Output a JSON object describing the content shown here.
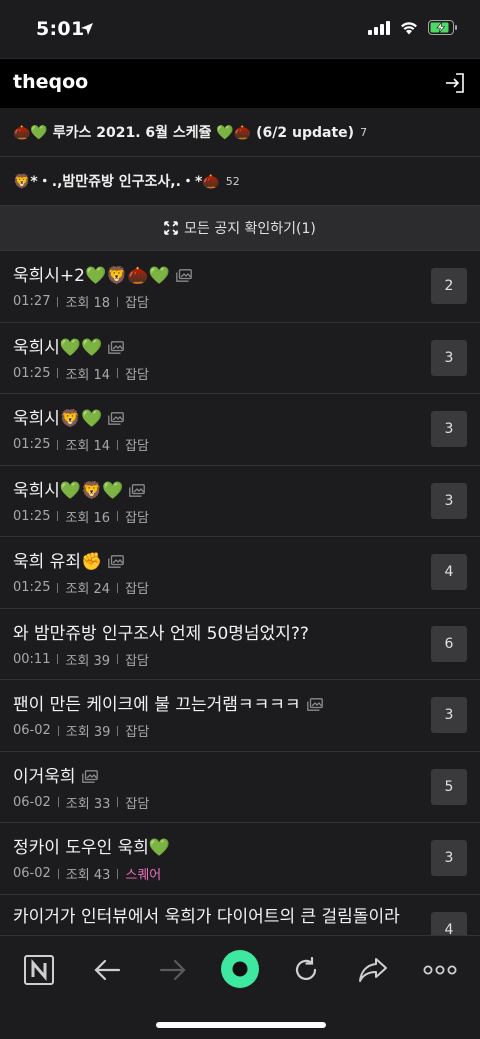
{
  "status": {
    "time": "5:01"
  },
  "nav": {
    "title": "theqoo"
  },
  "notices": [
    {
      "text": "🌰💚 루카스 2021. 6월 스케쥴 💚🌰 (6/2 update)",
      "count": "7"
    },
    {
      "text": "🦁*・.,밤만쥬방 인구조사,.・*🌰",
      "count": "52"
    }
  ],
  "all_notices": {
    "label": "모든 공지 확인하기(1)"
  },
  "posts": [
    {
      "title": "욱희시+2💚🦁🌰💚",
      "has_image": true,
      "time": "01:27",
      "views": "조회 18",
      "category": "잡담",
      "comments": "2"
    },
    {
      "title": "욱희시💚💚",
      "has_image": true,
      "time": "01:25",
      "views": "조회 14",
      "category": "잡담",
      "comments": "3"
    },
    {
      "title": "욱희시🦁💚",
      "has_image": true,
      "time": "01:25",
      "views": "조회 14",
      "category": "잡담",
      "comments": "3"
    },
    {
      "title": "욱희시💚🦁💚",
      "has_image": true,
      "time": "01:25",
      "views": "조회 16",
      "category": "잡담",
      "comments": "3"
    },
    {
      "title": "욱희 유죄✊",
      "has_image": true,
      "time": "01:25",
      "views": "조회 24",
      "category": "잡담",
      "comments": "4"
    },
    {
      "title": "와 밤만쥬방 인구조사 언제 50명넘었지??",
      "has_image": false,
      "time": "00:11",
      "views": "조회 39",
      "category": "잡담",
      "comments": "6"
    },
    {
      "title": "팬이 만든 케이크에 불 끄는거램ㅋㅋㅋㅋ",
      "has_image": true,
      "time": "06-02",
      "views": "조회 39",
      "category": "잡담",
      "comments": "3"
    },
    {
      "title": "이거욱희",
      "has_image": true,
      "time": "06-02",
      "views": "조회 33",
      "category": "잡담",
      "comments": "5"
    },
    {
      "title": "정카이 도우인 욱희💚",
      "has_image": false,
      "time": "06-02",
      "views": "조회 43",
      "category": "스퀘어",
      "comments": "3"
    },
    {
      "title": "카이거가 인터뷰에서 욱희가 다이어트의 큰 걸림돌이라 ㅋ ㅋㅋㅋ",
      "has_image": false,
      "time": "",
      "views": "",
      "category": "",
      "comments": "4"
    }
  ],
  "colors": {
    "background": "#1c1c1e",
    "accent_green": "#3ee8a0",
    "category_pink": "#e76fb8"
  },
  "toolbar": {
    "icons": [
      "n-logo-icon",
      "back-arrow-icon",
      "forward-arrow-icon",
      "home-dot-icon",
      "refresh-icon",
      "share-icon",
      "more-icon"
    ]
  }
}
